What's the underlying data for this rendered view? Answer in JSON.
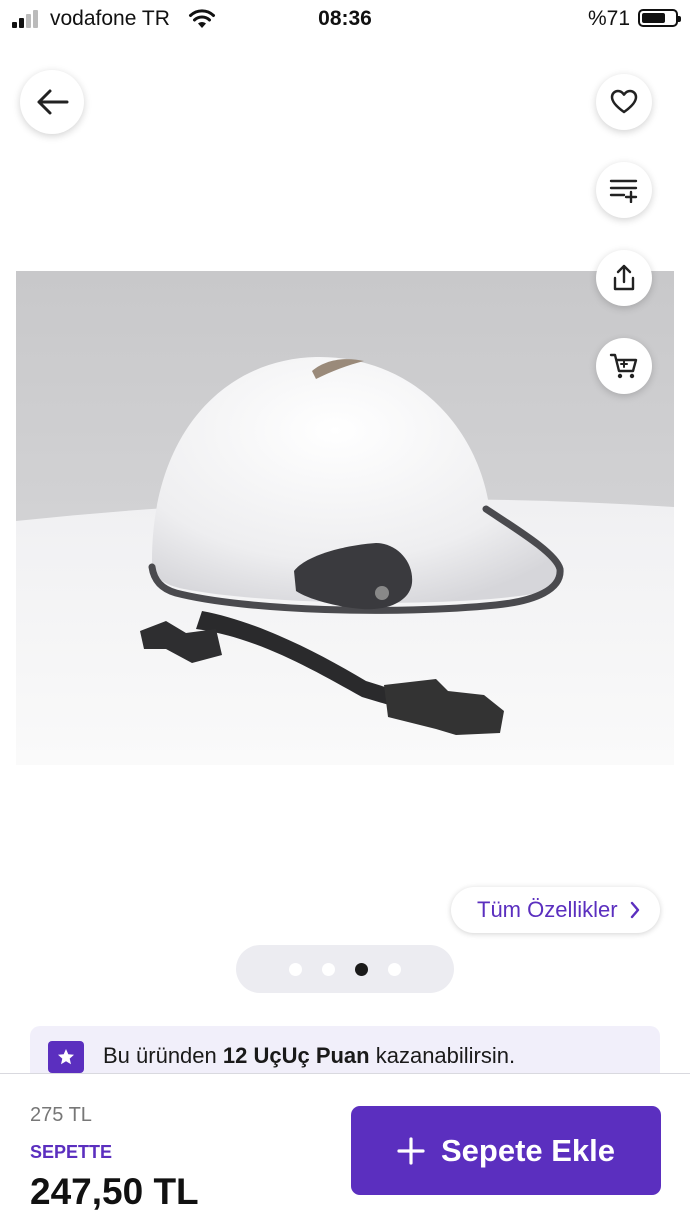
{
  "status_bar": {
    "carrier": "vodafone TR",
    "time": "08:36",
    "battery_percent": "%71",
    "battery_level": 0.71
  },
  "top_actions": {
    "back_icon": "arrow-left-icon",
    "favorite_icon": "heart-icon",
    "compare_icon": "list-add-icon",
    "share_icon": "share-icon",
    "cart_icon": "cart-icon"
  },
  "gallery": {
    "image": "white-helmet-product-photo",
    "total_images": 4,
    "active_index": 2
  },
  "all_features": {
    "label": "Tüm Özellikler"
  },
  "points_banner": {
    "prefix": "Bu üründen ",
    "highlight": "12 UçUç Puan",
    "suffix": " kazanabilirsin."
  },
  "purchase": {
    "old_price": "275 TL",
    "cart_label": "SEPETTE",
    "price": "247,50 TL",
    "add_button_label": "Sepete Ekle"
  },
  "colors": {
    "brand": "#5b2fbf",
    "banner_bg": "#f1effa"
  }
}
